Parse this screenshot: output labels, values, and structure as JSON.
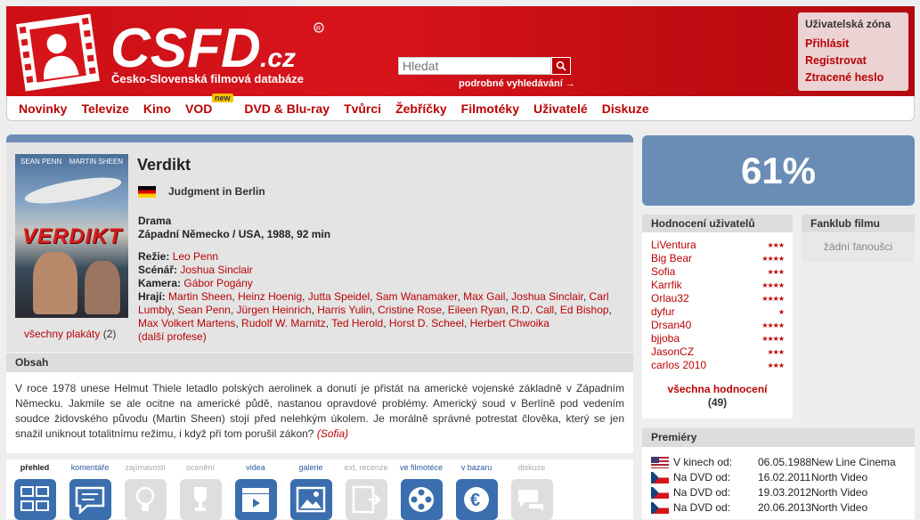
{
  "header": {
    "logo_text": "CSFD.cz",
    "tagline": "Česko-Slovenská filmová databáze",
    "search_placeholder": "Hledat",
    "advanced_search": "podrobné vyhledávání →"
  },
  "userzone": {
    "title": "Uživatelská zóna",
    "links": [
      "Přihlásit",
      "Registrovat",
      "Ztracené heslo"
    ]
  },
  "nav": {
    "items": [
      "Novinky",
      "Televize",
      "Kino",
      "VOD",
      "DVD & Blu-ray",
      "Tvůrci",
      "Žebříčky",
      "Filmotéky",
      "Uživatelé",
      "Diskuze"
    ],
    "new_badge": "new"
  },
  "film": {
    "title": "Verdikt",
    "original_title": "Judgment in Berlin",
    "genre": "Drama",
    "origin": "Západní Německo / USA, 1988, 92 min",
    "poster_text": "VERDIKT",
    "poster_names": [
      "SEAN PENN",
      "MARTIN SHEEN"
    ],
    "posters_link": "všechny plakáty",
    "posters_count": "(2)",
    "director_label": "Režie:",
    "director": "Leo Penn",
    "writer_label": "Scénář:",
    "writer": "Joshua Sinclair",
    "camera_label": "Kamera:",
    "camera": "Gábor Pogány",
    "cast_label": "Hrají:",
    "cast": [
      "Martin Sheen",
      "Heinz Hoenig",
      "Jutta Speidel",
      "Sam Wanamaker",
      "Max Gail",
      "Joshua Sinclair",
      "Carl Lumbly",
      "Sean Penn",
      "Jürgen Heinrich",
      "Harris Yulin",
      "Cristine Rose",
      "Eileen Ryan",
      "R.D. Call",
      "Ed Bishop",
      "Max Volkert Martens",
      "Rudolf W. Marnitz",
      "Ted Herold",
      "Horst D. Scheel",
      "Herbert Chwoika"
    ],
    "more_professions": "(další profese)"
  },
  "obsah": {
    "heading": "Obsah",
    "text": "V roce 1978 unese Helmut Thiele letadlo polských aerolinek a donutí je přistát na americké vojenské základně v Západním Německu. Jakmile se ale ocitne na americké půdě, nastanou opravdové problémy. Americký soud v Berlíně pod vedením soudce židovského původu (Martin Sheen) stojí před nelehkým úkolem. Je morálně správné potrestat člověka, který se jen snažil uniknout totalitnímu režimu, i když při tom porušil zákon?",
    "author": "(Sofia)"
  },
  "tabs": [
    {
      "label": "přehled",
      "state": "on",
      "icon": "overview-icon"
    },
    {
      "label": "komentáře",
      "state": "act",
      "icon": "comments-icon"
    },
    {
      "label": "zajímavosti",
      "state": "dis",
      "icon": "lightbulb-icon"
    },
    {
      "label": "ocenění",
      "state": "dis",
      "icon": "award-icon"
    },
    {
      "label": "videa",
      "state": "act",
      "icon": "clapper-icon"
    },
    {
      "label": "galerie",
      "state": "act",
      "icon": "gallery-icon"
    },
    {
      "label": "ext. recenze",
      "state": "dis",
      "icon": "external-review-icon"
    },
    {
      "label": "ve filmotéce",
      "state": "act",
      "icon": "film-reel-icon"
    },
    {
      "label": "v bazaru",
      "state": "act",
      "icon": "euro-icon"
    },
    {
      "label": "diskuze",
      "state": "dis",
      "icon": "discussion-icon"
    }
  ],
  "rating": {
    "value": "61%",
    "color": "#6a8db6"
  },
  "user_ratings": {
    "heading": "Hodnocení uživatelů",
    "rows": [
      {
        "user": "LiVentura",
        "stars": "★★★"
      },
      {
        "user": "Big Bear",
        "stars": "★★★★"
      },
      {
        "user": "Sofia",
        "stars": "★★★"
      },
      {
        "user": "Karrfik",
        "stars": "★★★★"
      },
      {
        "user": "Orlau32",
        "stars": "★★★★"
      },
      {
        "user": "dyfur",
        "stars": "★"
      },
      {
        "user": "Drsan40",
        "stars": "★★★★"
      },
      {
        "user": "bjjoba",
        "stars": "★★★★"
      },
      {
        "user": "JasonCZ",
        "stars": "★★★"
      },
      {
        "user": "carlos 2010",
        "stars": "★★★"
      }
    ],
    "all_link": "všechna hodnocení",
    "count": "(49)"
  },
  "fanclub": {
    "heading": "Fanklub filmu",
    "empty": "žádní fanoušci"
  },
  "premieres": {
    "heading": "Premiéry",
    "rows": [
      {
        "flag": "us",
        "label": "V kinech od:",
        "date": "06.05.1988",
        "dist": "New Line Cinema"
      },
      {
        "flag": "cz",
        "label": "Na DVD od:",
        "date": "16.02.2011",
        "dist": "North Video"
      },
      {
        "flag": "cz",
        "label": "Na DVD od:",
        "date": "19.03.2012",
        "dist": "North Video"
      },
      {
        "flag": "cz",
        "label": "Na DVD od:",
        "date": "20.06.2013",
        "dist": "North Video"
      }
    ]
  },
  "colors": {
    "brand_red": "#ba0305",
    "header_red": "#d8141b",
    "accent_blue": "#6e8db5"
  }
}
